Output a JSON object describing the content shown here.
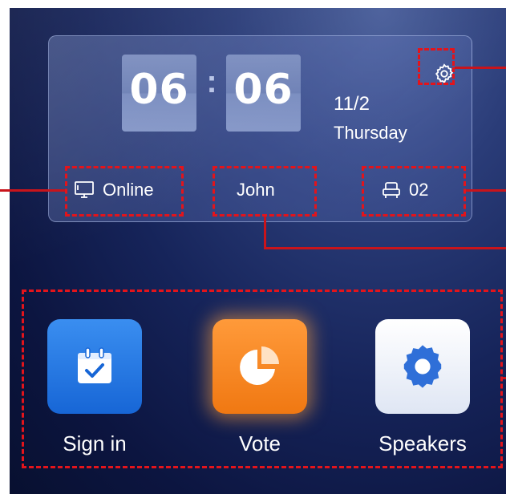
{
  "clock": {
    "hours": "06",
    "separator": ":",
    "minutes": "06"
  },
  "date": {
    "day": "11/2",
    "weekday": "Thursday"
  },
  "status": {
    "connection": "Online",
    "user": "John",
    "seat": "02"
  },
  "apps": [
    {
      "label": "Sign in",
      "icon": "calendar-check-icon"
    },
    {
      "label": "Vote",
      "icon": "pie-chart-icon"
    },
    {
      "label": "Speakers",
      "icon": "gear-icon"
    }
  ],
  "icons": {
    "settings": "gear-icon",
    "connection": "monitor-icon",
    "seat": "seat-icon"
  },
  "colors": {
    "annotation": "#e3141b",
    "vote_accent": "#f07812",
    "signin_accent": "#1766d6"
  }
}
